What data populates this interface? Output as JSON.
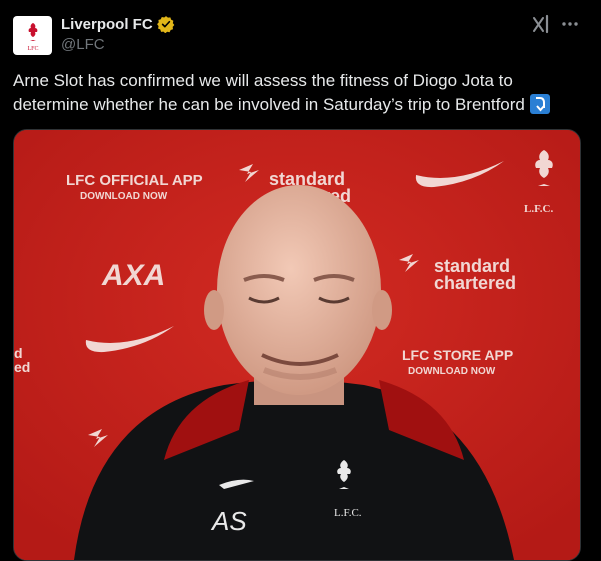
{
  "tweet": {
    "display_name": "Liverpool FC",
    "handle": "@LFC",
    "text": "Arne Slot has confirmed we will assess the fitness of Diogo Jota to determine whether he can be involved in Saturday’s trip to Brentford",
    "verified": true,
    "avatar_logo_text": "LFC"
  },
  "icons": {
    "verified": "verified-badge-icon",
    "grok": "grok-icon",
    "more": "more-icon",
    "emoji": "right-arrow-curving-down-emoji"
  },
  "media": {
    "backdrop_texts": {
      "app_line1": "LFC OFFICIAL APP",
      "app_line2": "DOWNLOAD NOW",
      "sponsor1": "standard",
      "sponsor2": "chartered",
      "axa": "AXA",
      "store_line1": "LFC STORE APP",
      "store_line2": "DOWNLOAD NOW",
      "crest_text": "L.F.C.",
      "edge_left": "d\ned",
      "shirt_initials": "AS",
      "shirt_crest": "L.F.C."
    }
  },
  "colors": {
    "background": "#000000",
    "text": "#e7e9ea",
    "muted": "#71767b",
    "verified_gold": "#e2b719",
    "lfc_red": "#c9221c",
    "emoji_blue": "#2a7fd4"
  }
}
